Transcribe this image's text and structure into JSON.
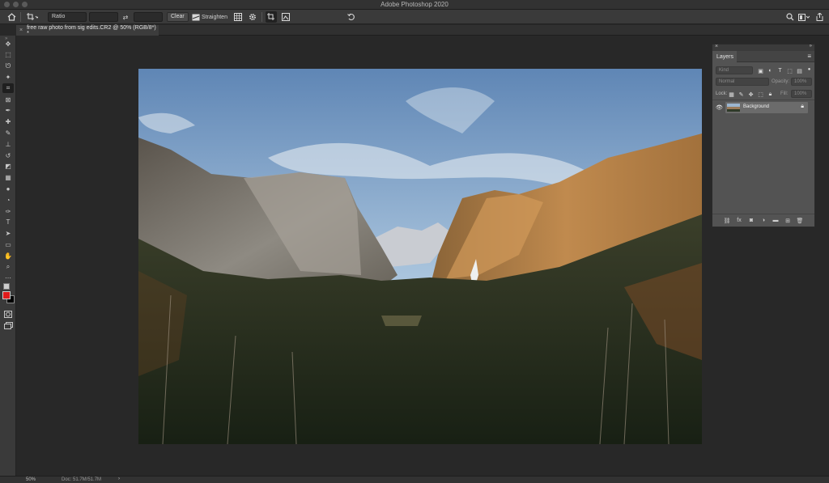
{
  "app": {
    "title": "Adobe Photoshop 2020"
  },
  "options_bar": {
    "ratio_select": "Ratio",
    "clear_label": "Clear",
    "straighten_label": "Straighten"
  },
  "document": {
    "tab_title": "free raw photo from sig edits.CR2 @ 50% (RGB/8*) *"
  },
  "colors": {
    "foreground": "#e01b1b",
    "background": "#000000",
    "accent": "#4a90e2"
  },
  "tools": [
    "move-icon",
    "marquee-icon",
    "lasso-icon",
    "magic-wand-icon",
    "crop-icon",
    "frame-icon",
    "eyedropper-icon",
    "healing-brush-icon",
    "brush-icon",
    "clone-stamp-icon",
    "history-brush-icon",
    "eraser-icon",
    "gradient-icon",
    "blur-icon",
    "dodge-icon",
    "pen-icon",
    "type-icon",
    "path-selection-icon",
    "rectangle-icon",
    "hand-icon",
    "zoom-icon",
    "more-icon"
  ],
  "layers_panel": {
    "tab_label": "Layers",
    "filter_placeholder": "Kind",
    "blend_mode": "Normal",
    "opacity_label": "Opacity:",
    "opacity_value": "100%",
    "lock_label": "Lock:",
    "fill_label": "Fill:",
    "fill_value": "100%",
    "layers": [
      {
        "name": "Background",
        "visible": true,
        "locked": true
      }
    ]
  },
  "status": {
    "zoom": "50%",
    "doc_size": "Doc: 51.7M/51.7M"
  }
}
